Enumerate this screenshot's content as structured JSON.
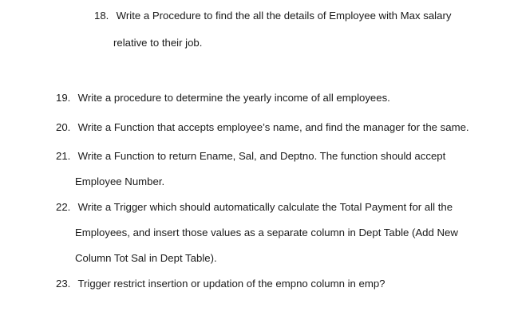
{
  "items": [
    {
      "number": "18.",
      "lines": [
        "Write a Procedure to find the all the details of Employee with Max salary",
        "relative to their job."
      ]
    },
    {
      "number": "19.",
      "lines": [
        "Write a procedure to determine the yearly income of all employees."
      ]
    },
    {
      "number": "20.",
      "lines": [
        "Write a Function that accepts employee’s name, and find the manager for the same."
      ]
    },
    {
      "number": "21.",
      "lines": [
        "Write a Function to return Ename, Sal, and Deptno. The function should accept",
        "Employee Number."
      ]
    },
    {
      "number": "22.",
      "lines": [
        "Write a Trigger which should automatically calculate the Total Payment for all the",
        "Employees, and insert those values as a separate column in Dept Table (Add New",
        "Column Tot Sal in Dept Table)."
      ]
    },
    {
      "number": "23.",
      "lines": [
        "Trigger restrict insertion or updation of the empno column in emp?"
      ]
    }
  ]
}
